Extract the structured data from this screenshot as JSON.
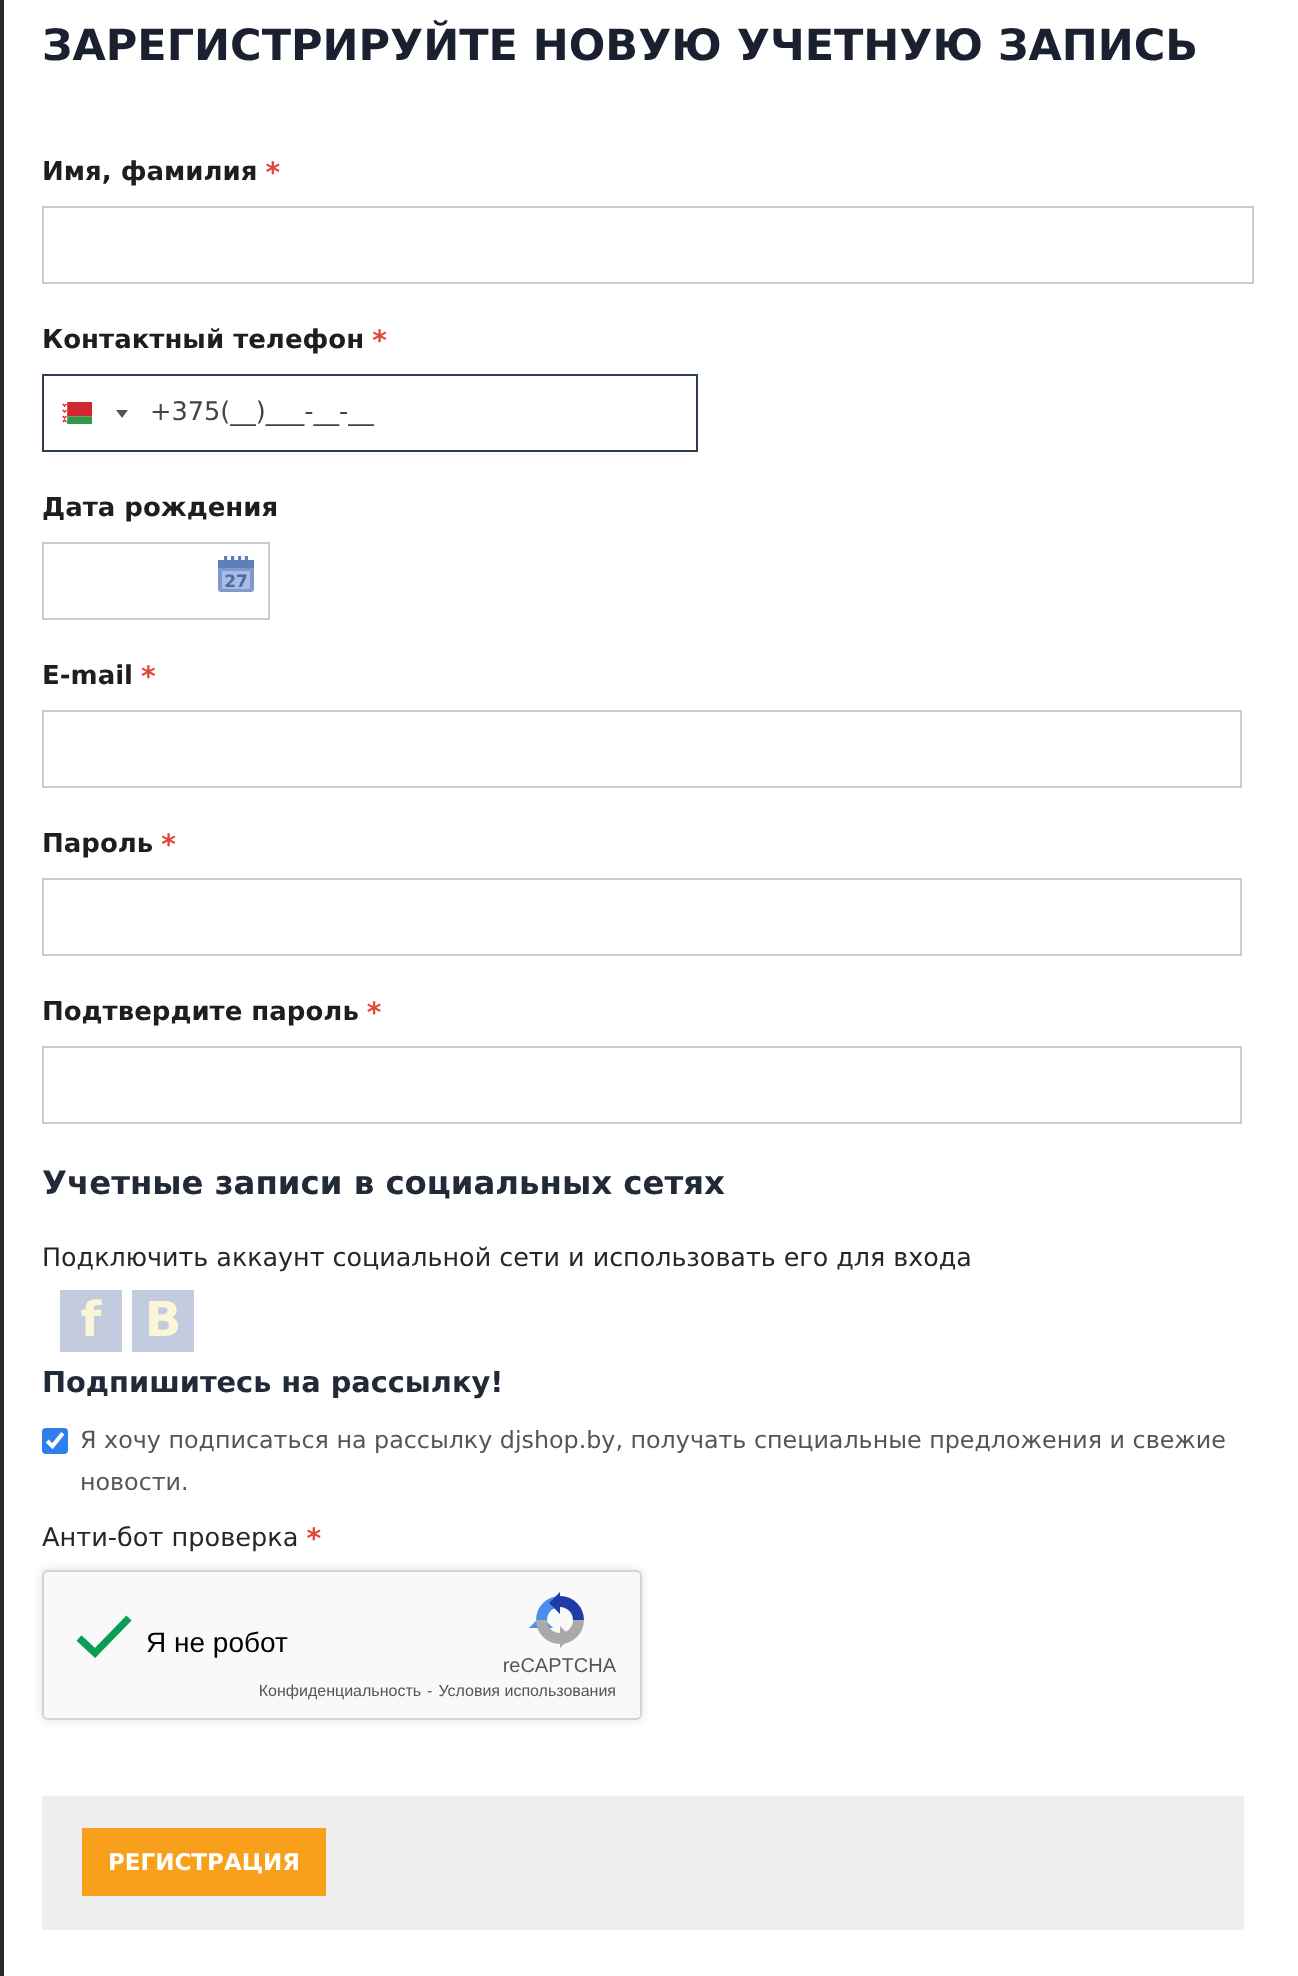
{
  "title": "ЗАРЕГИСТРИРУЙТЕ НОВУЮ УЧЕТНУЮ ЗАПИСЬ",
  "fields": [
    {
      "kind": "text",
      "label": "Имя, фамилия",
      "required_mark": "*"
    },
    {
      "kind": "phone",
      "label": "Контактный телефон",
      "required_mark": "*",
      "value": "+375(__)___-__-__",
      "focused": true
    },
    {
      "kind": "date",
      "label": "Дата рождения",
      "calendar_day": "27"
    },
    {
      "kind": "email",
      "label": "E-mail",
      "required_mark": "*"
    },
    {
      "kind": "password",
      "label": "Пароль",
      "required_mark": "*"
    },
    {
      "kind": "password",
      "label": "Подтвердите пароль",
      "required_mark": "*"
    }
  ],
  "social": {
    "title": "Учетные записи в социальных сетях",
    "text": "Подключить аккаунт социальной сети и использовать его для входа",
    "buttons": [
      {
        "letter": "f"
      },
      {
        "letter": "B"
      }
    ]
  },
  "newsletter": {
    "title": "Подпишитесь на рассылку!",
    "checked": true,
    "text": "Я хочу подписаться на рассылку djshop.by, получать специальные предложения и свежие новости."
  },
  "antibot": {
    "label": "Анти-бот проверка",
    "required_mark": "*",
    "captcha": {
      "checked": true,
      "text": "Я не робот",
      "brand": "reCAPTCHA",
      "links": [
        "Конфиденциальность",
        "Условия использования"
      ],
      "separator": "-"
    }
  },
  "submit": {
    "label": "РЕГИСТРАЦИЯ"
  }
}
